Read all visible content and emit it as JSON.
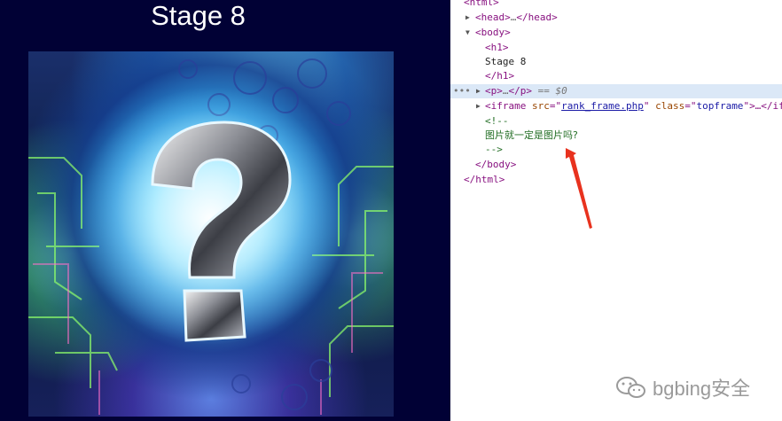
{
  "page": {
    "title": "Stage 8",
    "image_alt": "question mark"
  },
  "devtools": {
    "html_open": "<html>",
    "head_open": "<head>",
    "head_ellipsis": "…",
    "head_close": "</head>",
    "body_open": "<body>",
    "h1_open": "<h1>",
    "h1_text": "Stage 8",
    "h1_close": "</h1>",
    "p_open": "<p>",
    "p_ellipsis": "…",
    "p_close": "</p>",
    "p_suffix": "== $0",
    "ellipsis_marker": "•••",
    "iframe_open": "<iframe",
    "iframe_src_attr": "src",
    "iframe_src_value": "rank_frame.php",
    "iframe_class_attr": "class",
    "iframe_class_value": "topframe",
    "iframe_rest": ">…</if",
    "comment_open": "<!--",
    "comment_text": "图片就一定是图片吗?",
    "comment_close": "-->",
    "body_close": "</body>",
    "html_close": "</html>"
  },
  "watermark": {
    "text": "bgbing安全",
    "icon": "wechat-icon"
  },
  "colors": {
    "page_background": "#010135",
    "devtools_selection": "#dbe8f7",
    "tag": "#881280",
    "comment": "#236e25",
    "arrow": "#e8321e"
  }
}
